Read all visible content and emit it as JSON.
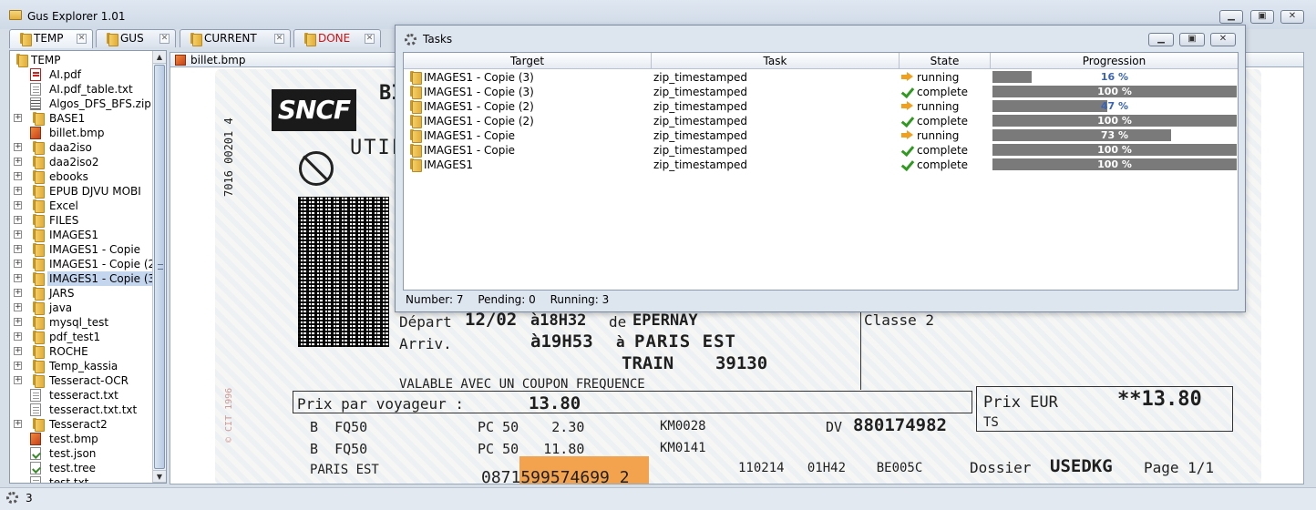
{
  "app": {
    "title": "Gus Explorer 1.01"
  },
  "tabs": [
    {
      "label": "TEMP",
      "active": true,
      "color": "#000000"
    },
    {
      "label": "GUS",
      "active": false,
      "color": "#000000"
    },
    {
      "label": "CURRENT",
      "active": false,
      "color": "#000000"
    },
    {
      "label": "DONE",
      "active": false,
      "color": "#d01010"
    }
  ],
  "tree": {
    "root": "TEMP",
    "items": [
      {
        "label": "AI.pdf",
        "type": "pdf",
        "expandable": false
      },
      {
        "label": "AI.pdf_table.txt",
        "type": "txt",
        "expandable": false
      },
      {
        "label": "Algos_DFS_BFS.zip",
        "type": "zip",
        "expandable": false
      },
      {
        "label": "BASE1",
        "type": "folder",
        "expandable": true
      },
      {
        "label": "billet.bmp",
        "type": "bmp",
        "expandable": false
      },
      {
        "label": "daa2iso",
        "type": "folder",
        "expandable": true
      },
      {
        "label": "daa2iso2",
        "type": "folder",
        "expandable": true
      },
      {
        "label": "ebooks",
        "type": "folder",
        "expandable": true
      },
      {
        "label": "EPUB DJVU MOBI",
        "type": "folder",
        "expandable": true
      },
      {
        "label": "Excel",
        "type": "folder",
        "expandable": true
      },
      {
        "label": "FILES",
        "type": "folder",
        "expandable": true
      },
      {
        "label": "IMAGES1",
        "type": "folder",
        "expandable": true
      },
      {
        "label": "IMAGES1 - Copie",
        "type": "folder",
        "expandable": true
      },
      {
        "label": "IMAGES1 - Copie (2)",
        "type": "folder",
        "expandable": true
      },
      {
        "label": "IMAGES1 - Copie (3)",
        "type": "folder",
        "expandable": true,
        "selected": true
      },
      {
        "label": "JARS",
        "type": "folder",
        "expandable": true
      },
      {
        "label": "java",
        "type": "folder",
        "expandable": true
      },
      {
        "label": "mysql_test",
        "type": "folder",
        "expandable": true
      },
      {
        "label": "pdf_test1",
        "type": "folder",
        "expandable": true
      },
      {
        "label": "ROCHE",
        "type": "folder",
        "expandable": true
      },
      {
        "label": "Temp_kassia",
        "type": "folder",
        "expandable": true
      },
      {
        "label": "Tesseract-OCR",
        "type": "folder",
        "expandable": true
      },
      {
        "label": "tesseract.txt",
        "type": "txt",
        "expandable": false
      },
      {
        "label": "tesseract.txt.txt",
        "type": "txt",
        "expandable": false
      },
      {
        "label": "Tesseract2",
        "type": "folder",
        "expandable": true
      },
      {
        "label": "test.bmp",
        "type": "bmp",
        "expandable": false
      },
      {
        "label": "test.json",
        "type": "json",
        "expandable": false
      },
      {
        "label": "test.tree",
        "type": "json",
        "expandable": false
      },
      {
        "label": "test.txt",
        "type": "txt",
        "expandable": false
      }
    ]
  },
  "viewer": {
    "filename": "billet.bmp",
    "ticket": {
      "logo": "SNCF",
      "side_number": "7016 00201 4",
      "depart_label": "Départ",
      "depart_date": "12/02",
      "depart_time": "à18H32",
      "depart_de": "de",
      "depart_city": "EPERNAY",
      "arriv_label": "Arriv.",
      "arriv_time": "à19H53",
      "arriv_a": "à",
      "arriv_city": "PARIS EST",
      "train": "TRAIN    39130",
      "classe": "Classe 2",
      "valable": "VALABLE AVEC UN COUPON FREQUENCE",
      "prix_label": "Prix par voyageur :",
      "prix_value": "13.80",
      "prix_eur_label": "Prix EUR",
      "prix_eur_value": "**13.80",
      "ts": "TS",
      "line1": "B  FQ50",
      "line1_pc": "PC 50    2.30",
      "line1_km": "KM0028",
      "dv_label": "DV",
      "dv_value": "880174982",
      "line2": "B  FQ50",
      "line2_pc": "PC 50   11.80",
      "line2_km": "KM0141",
      "paris": "PARIS EST",
      "code": "110214   01H42    BE005C",
      "barnum": "0871599574699 2",
      "dossier_label": "Dossier",
      "dossier_value": "USEDKG",
      "page": "Page 1/1",
      "cit": "© CIT 1996",
      "top_title": "BI",
      "util": "UTIL"
    }
  },
  "tasks_dialog": {
    "title": "Tasks",
    "columns": [
      "Target",
      "Task",
      "State",
      "Progression"
    ],
    "rows": [
      {
        "target": "IMAGES1 - Copie (3)",
        "task": "zip_timestamped",
        "state": "running",
        "progress": 16,
        "label": "16 %"
      },
      {
        "target": "IMAGES1 - Copie (3)",
        "task": "zip_timestamped",
        "state": "complete",
        "progress": 100,
        "label": "100 %"
      },
      {
        "target": "IMAGES1 - Copie (2)",
        "task": "zip_timestamped",
        "state": "running",
        "progress": 47,
        "label": "47 %"
      },
      {
        "target": "IMAGES1 - Copie (2)",
        "task": "zip_timestamped",
        "state": "complete",
        "progress": 100,
        "label": "100 %"
      },
      {
        "target": "IMAGES1 - Copie",
        "task": "zip_timestamped",
        "state": "running",
        "progress": 73,
        "label": "73 %"
      },
      {
        "target": "IMAGES1 - Copie",
        "task": "zip_timestamped",
        "state": "complete",
        "progress": 100,
        "label": "100 %"
      },
      {
        "target": "IMAGES1",
        "task": "zip_timestamped",
        "state": "complete",
        "progress": 100,
        "label": "100 %"
      }
    ],
    "status": {
      "number": "Number: 7",
      "pending": "Pending: 0",
      "running": "Running: 3"
    }
  },
  "statusbar": {
    "count": "3"
  }
}
